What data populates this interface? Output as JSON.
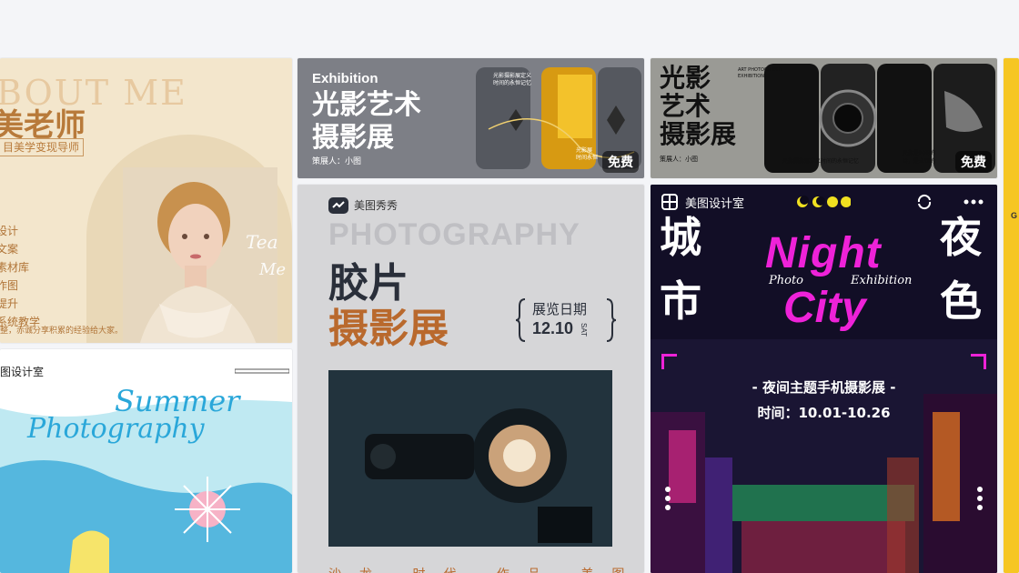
{
  "colors": {
    "page_bg": "#f4f5f8",
    "badge_bg": "rgba(0,0,0,0.55)",
    "night_accent": "#ee22d8",
    "film_accent": "#b9692d",
    "summer_blue": "#2aa7d9",
    "about_brown": "#b87a3a"
  },
  "cards": {
    "about": {
      "bg_text": "BOUT ME",
      "title": "美老师",
      "subtitle": "目美学变现导师",
      "list": [
        "设计",
        "文案",
        "素材库",
        "作图",
        "提升",
        "系统教学"
      ],
      "note": "整，赤诚分享积累的经验给大家。",
      "script_a": "Tea",
      "script_b": "Me"
    },
    "exhibition_1": {
      "en_title": "Exhibition",
      "title_line1": "光影艺术",
      "title_line2": "摄影展",
      "planner": "策展人：小图",
      "tiny_text": "光影摄影展定义\n时间的永恒记忆",
      "tiny_text2": "光影展\n时间永恒",
      "badge": "免费",
      "icon": "sparkle-icon"
    },
    "exhibition_2": {
      "title_line1": "光影",
      "title_line2": "艺术",
      "title_line3": "摄影展",
      "planner": "策展人：小图",
      "tiny_text": "ART PHOTOGRAPHY EXHIBITION",
      "tiny_text2": "光影摄影展定义时间的永恒记忆",
      "tiny_text3": "光影是时间的\n诗，是永恒的",
      "badge": "免费",
      "icon": "camera-icon"
    },
    "film": {
      "brand": "美图秀秀",
      "en_title": "PHOTOGRAPHY",
      "title_line1": "胶片",
      "title_line2": "摄影展",
      "date_label": "展览日期",
      "date_value": "12.10",
      "date_day": "SAT",
      "bottom_text": "沙龙 时代 作品 美图 传统",
      "icon": "meitu-logo-icon"
    },
    "night": {
      "brand": "美图设计室",
      "left_chars": [
        "城",
        "市"
      ],
      "right_chars": [
        "夜",
        "色"
      ],
      "night": "Night",
      "city": "City",
      "photo": "Photo",
      "exhibition": "Exhibition",
      "subtitle": "- 夜间主题手机摄影展 -",
      "time": "时间：10.01-10.26",
      "icons": [
        "grid-icon",
        "refresh-icon",
        "more-icon"
      ]
    },
    "summer": {
      "brand": "图设计室",
      "script_1": "Summer",
      "script_2": "Photography"
    },
    "yellow": {
      "text": "G"
    }
  }
}
